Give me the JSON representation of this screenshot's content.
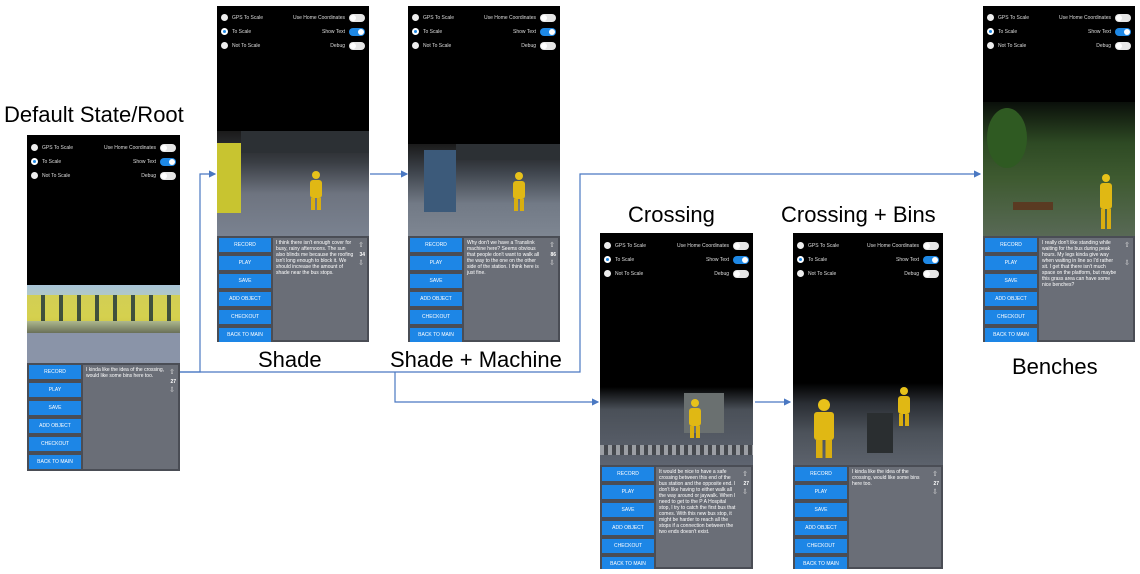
{
  "captions": {
    "root": "Default State/Root",
    "shade": "Shade",
    "shade_machine": "Shade + Machine",
    "crossing": "Crossing",
    "crossing_bins": "Crossing + Bins",
    "benches": "Benches"
  },
  "options": {
    "gps": "GPS To Scale",
    "to_scale": "To Scale",
    "not_to_scale": "Not To Scale",
    "home_coords": "Use Home Coordinates",
    "show_text": "Show Text",
    "debug": "Debug"
  },
  "buttons": {
    "record": "RECORD",
    "play": "PLAY",
    "save": "SAVE",
    "add_object": "ADD OBJECT",
    "checkout": "CHECKOUT",
    "back": "BACK TO MAIN"
  },
  "screens": {
    "root": {
      "text": "I kinda like the idea of the crossing, would like some bins here too.",
      "count": "27"
    },
    "shade": {
      "text": "I think there isn't enough cover for busy, rainy afternoons. The sun also blinds me because the roofing isn't long enough to block it. We should increase the amount of shade near the bus stops.",
      "count": "34"
    },
    "shade_machine": {
      "text": "Why don't we have a Translink machine here? Seems obvious that people don't want to walk all the way to the one on the other side of the station. I think here is just fine.",
      "count": "86"
    },
    "crossing": {
      "text": "It would be nice to have a safe crossing between this end of the bus station and the opposite end. I don't like having to either walk all the way around or jaywalk. When I need to get to the P A Hospital stop, I try to catch the first bus that comes. With this new bus stop, it might be harder to reach all the stops if a connection between the two ends doesn't exist.",
      "count": "27"
    },
    "crossing_bins": {
      "text": "I kinda like the idea of the crossing, would like some bins here too.",
      "count": "27"
    },
    "benches": {
      "text": "I really don't like standing while waiting for the bus during peak hours. My legs kinda give way when waiting in line so I'd rather sit. I get that there isn't much space on the platform, but maybe this grass area can have some nice benches?",
      "count": ""
    }
  },
  "colors": {
    "accent": "#1d86e6",
    "arrow": "#4a78c2"
  }
}
